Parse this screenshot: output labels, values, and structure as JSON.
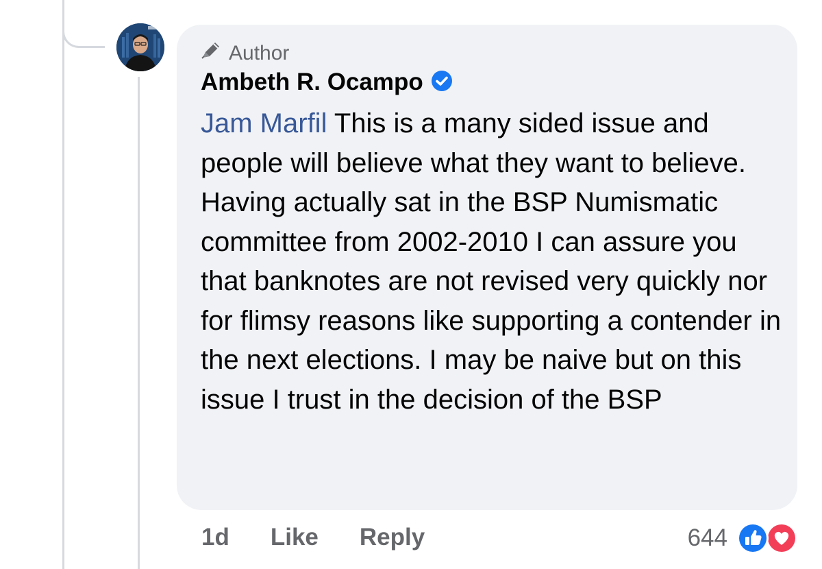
{
  "comment": {
    "author_badge_label": "Author",
    "author_name": "Ambeth R. Ocampo",
    "mention": "Jam Marfil",
    "text": " This is a many sided issue and people will believe what they want to believe. Having actually sat in the BSP Numismatic committee from 2002-2010 I can assure you that banknotes are not revised very quickly nor for flimsy reasons like supporting a contender in the next elections. I may be naive but on this issue I trust in the decision of the BSP",
    "timestamp": "1d",
    "like_label": "Like",
    "reply_label": "Reply",
    "reaction_count": "644"
  },
  "icons": {
    "author_badge": "pencil-icon",
    "verified": "verified-badge-icon",
    "reaction_like": "like-reaction-icon",
    "reaction_love": "love-reaction-icon"
  },
  "colors": {
    "bubble": "#f0f2f5",
    "mention": "#385898",
    "verified": "#1877f2",
    "like": "#1877f2",
    "love": "#f33e58",
    "secondary_text": "#65676b"
  }
}
